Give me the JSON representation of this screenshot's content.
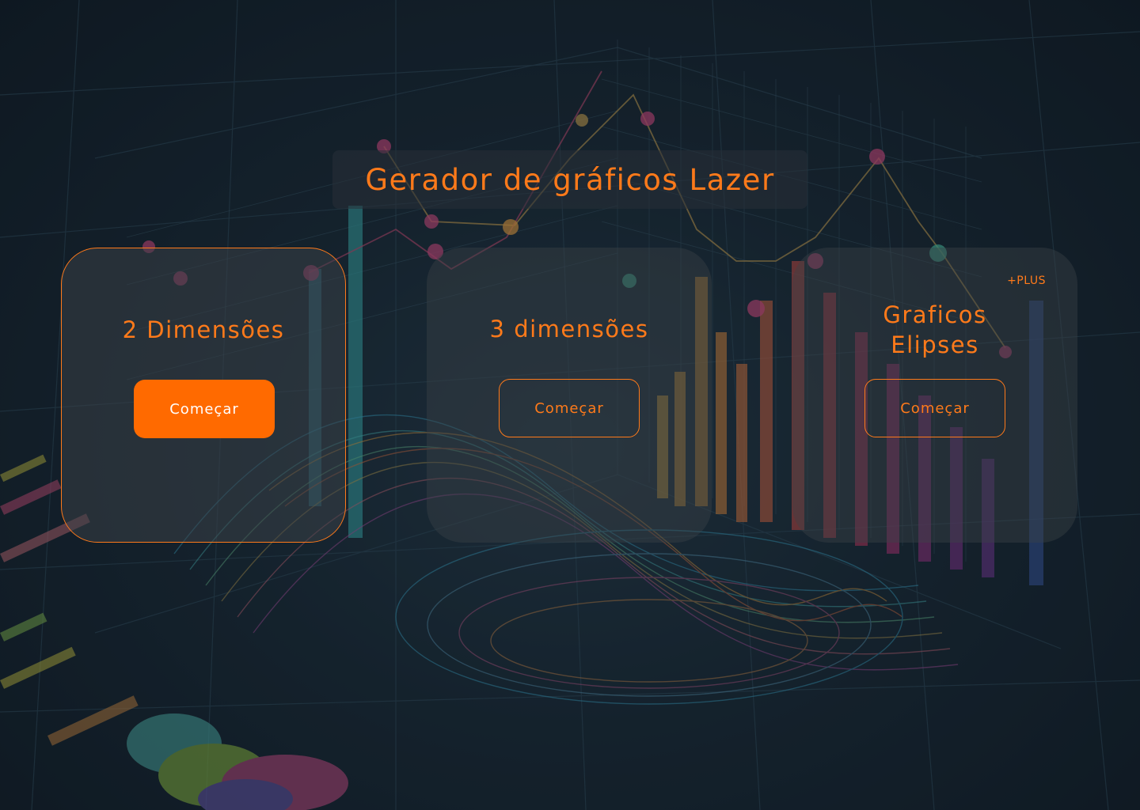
{
  "header": {
    "title": "Gerador de gráficos Lazer"
  },
  "cards": [
    {
      "title": "2 Dimensões",
      "button_label": "Começar",
      "badge": ""
    },
    {
      "title": "3 dimensões",
      "button_label": "Começar",
      "badge": ""
    },
    {
      "title": "Graficos Elipses",
      "button_label": "Começar",
      "badge": "+PLUS"
    }
  ],
  "background": {
    "description_icon": "data-visualization-illustration"
  },
  "colors": {
    "accent": "#ff7a1a",
    "button_fill": "#ff6a00",
    "button_text": "#ffffff",
    "card_background": "#3c4248",
    "page_background": "#13202b"
  }
}
